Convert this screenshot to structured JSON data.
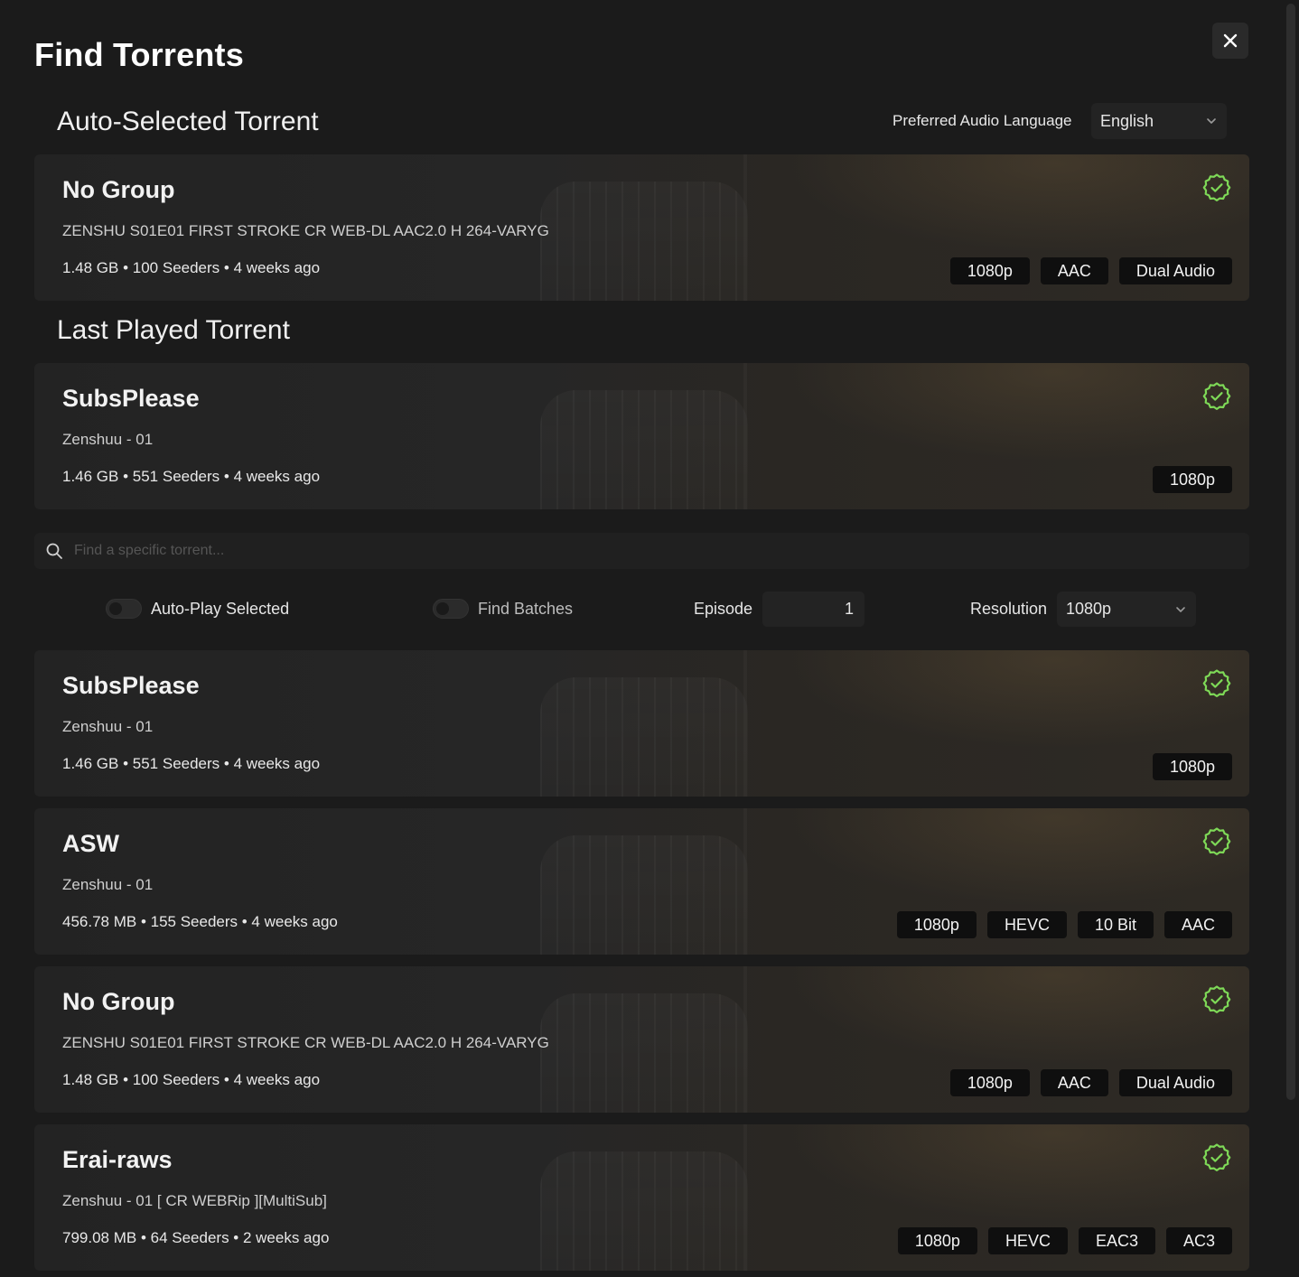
{
  "modal": {
    "title": "Find Torrents",
    "close_icon": "close-icon"
  },
  "auto_selected": {
    "heading": "Auto-Selected Torrent",
    "preferred_audio_label": "Preferred Audio Language",
    "preferred_audio_value": "English",
    "card": {
      "group": "No Group",
      "name": "ZENSHU S01E01 FIRST STROKE CR WEB-DL AAC2.0 H 264-VARYG",
      "meta": "1.48 GB • 100 Seeders • 4 weeks ago",
      "badges": [
        "1080p",
        "AAC",
        "Dual Audio"
      ]
    }
  },
  "last_played": {
    "heading": "Last Played Torrent",
    "card": {
      "group": "SubsPlease",
      "name": "Zenshuu - 01",
      "meta": "1.46 GB • 551 Seeders • 4 weeks ago",
      "badges": [
        "1080p"
      ]
    }
  },
  "search": {
    "placeholder": "Find a specific torrent..."
  },
  "controls": {
    "auto_play_label": "Auto-Play Selected",
    "find_batches_label": "Find Batches",
    "episode_label": "Episode",
    "episode_value": "1",
    "resolution_label": "Resolution",
    "resolution_value": "1080p"
  },
  "results": [
    {
      "group": "SubsPlease",
      "name": "Zenshuu - 01",
      "meta": "1.46 GB • 551 Seeders • 4 weeks ago",
      "badges": [
        "1080p"
      ]
    },
    {
      "group": "ASW",
      "name": "Zenshuu - 01",
      "meta": "456.78 MB • 155 Seeders • 4 weeks ago",
      "badges": [
        "1080p",
        "HEVC",
        "10 Bit",
        "AAC"
      ]
    },
    {
      "group": "No Group",
      "name": "ZENSHU S01E01 FIRST STROKE CR WEB-DL AAC2.0 H 264-VARYG",
      "meta": "1.48 GB • 100 Seeders • 4 weeks ago",
      "badges": [
        "1080p",
        "AAC",
        "Dual Audio"
      ]
    },
    {
      "group": "Erai-raws",
      "name": "Zenshuu - 01 [ CR WEBRip ][MultiSub]",
      "meta": "799.08 MB • 64 Seeders • 2 weeks ago",
      "badges": [
        "1080p",
        "HEVC",
        "EAC3",
        "AC3"
      ]
    }
  ],
  "colors": {
    "background": "#1b1b1b",
    "card": "#262626",
    "badge": "#0f0f0f",
    "check_accent": "#7ed957"
  }
}
